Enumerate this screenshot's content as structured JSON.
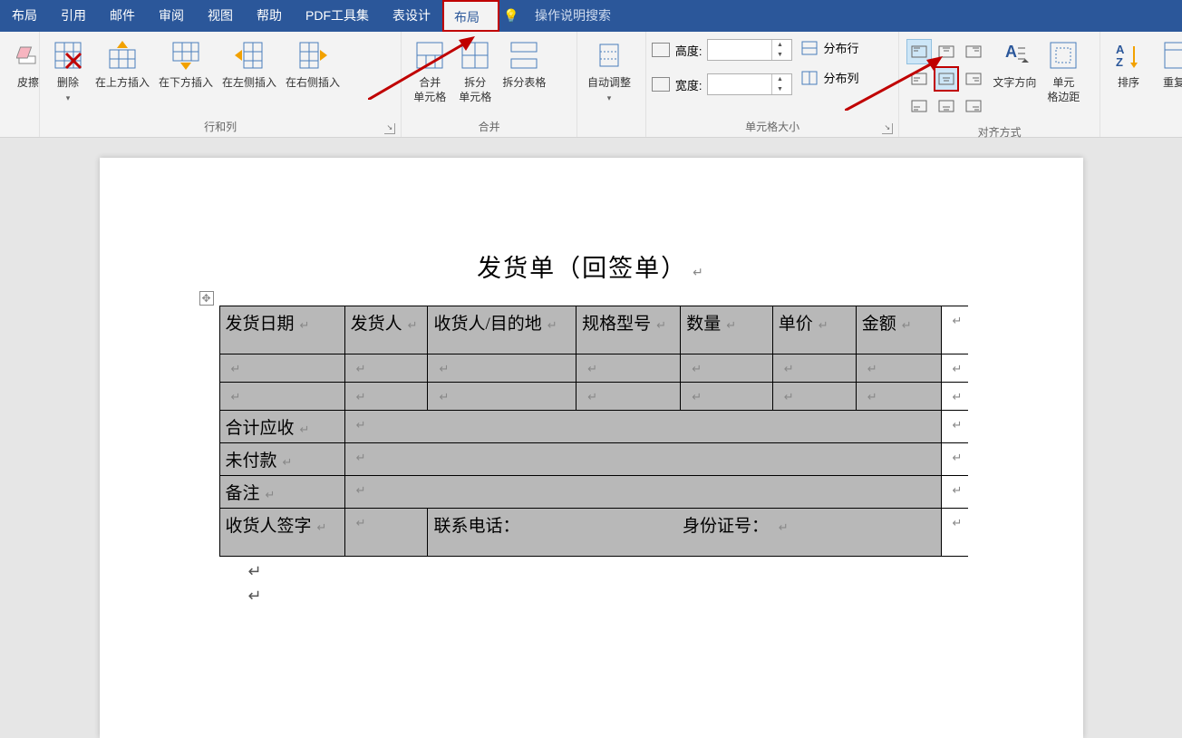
{
  "tabs": {
    "t0": "布局",
    "t1": "引用",
    "t2": "邮件",
    "t3": "审阅",
    "t4": "视图",
    "t5": "帮助",
    "t6": "PDF工具集",
    "t7": "表设计",
    "t8": "布局",
    "tellme": "操作说明搜索"
  },
  "ribbon": {
    "eraser": "皮擦",
    "delete": "删除",
    "insAbove": "在上方插入",
    "insBelow": "在下方插入",
    "insLeft": "在左侧插入",
    "insRight": "在右侧插入",
    "rowsColsGroup": "行和列",
    "mergeCells": "合并\n单元格",
    "splitCells": "拆分\n单元格",
    "splitTable": "拆分表格",
    "mergeGroup": "合并",
    "autofit": "自动调整",
    "heightLbl": "高度:",
    "widthLbl": "宽度:",
    "heightVal": "",
    "widthVal": "",
    "distRows": "分布行",
    "distCols": "分布列",
    "cellSizeGroup": "单元格大小",
    "alignGroup": "对齐方式",
    "textDir": "文字方向",
    "cellMargins": "单元\n格边距",
    "sort": "排序",
    "repeat": "重复"
  },
  "doc": {
    "title": "发货单（回签单）",
    "headers": {
      "c0": "发货日期",
      "c1": "发货人",
      "c2": "收货人/目的地",
      "c3": "规格型号",
      "c4": "数量",
      "c5": "单价",
      "c6": "金额"
    },
    "rows": {
      "total": "合计应收",
      "unpaid": "未付款",
      "remark": "备注",
      "sign": "收货人签字",
      "contact": "联系电话：",
      "idno": "身份证号："
    }
  }
}
